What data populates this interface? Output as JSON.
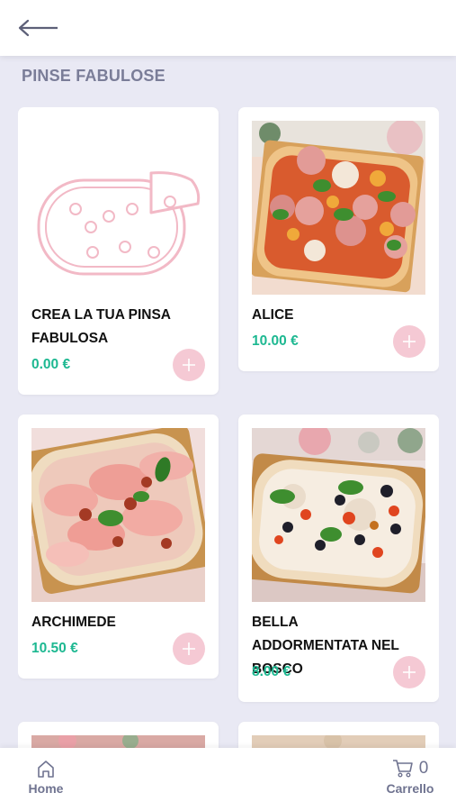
{
  "header": {
    "back_icon": "arrow-left-icon"
  },
  "section": {
    "title": "PINSE FABULOSE"
  },
  "colors": {
    "accent_green": "#1db891",
    "add_pink": "#f5c9d4",
    "title_gray": "#7a7d98"
  },
  "products": [
    {
      "name": "CREA LA TUA PINSA FABULOSA",
      "price": "0.00 €"
    },
    {
      "name": "ALICE",
      "price": "10.00 €"
    },
    {
      "name": "ARCHIMEDE",
      "price": "10.50 €"
    },
    {
      "name": "BELLA ADDORMENTATA NEL BOSCO",
      "price": "8.00 €"
    }
  ],
  "bottom_nav": {
    "home_label": "Home",
    "cart_label": "Carrello",
    "cart_count": "0"
  }
}
